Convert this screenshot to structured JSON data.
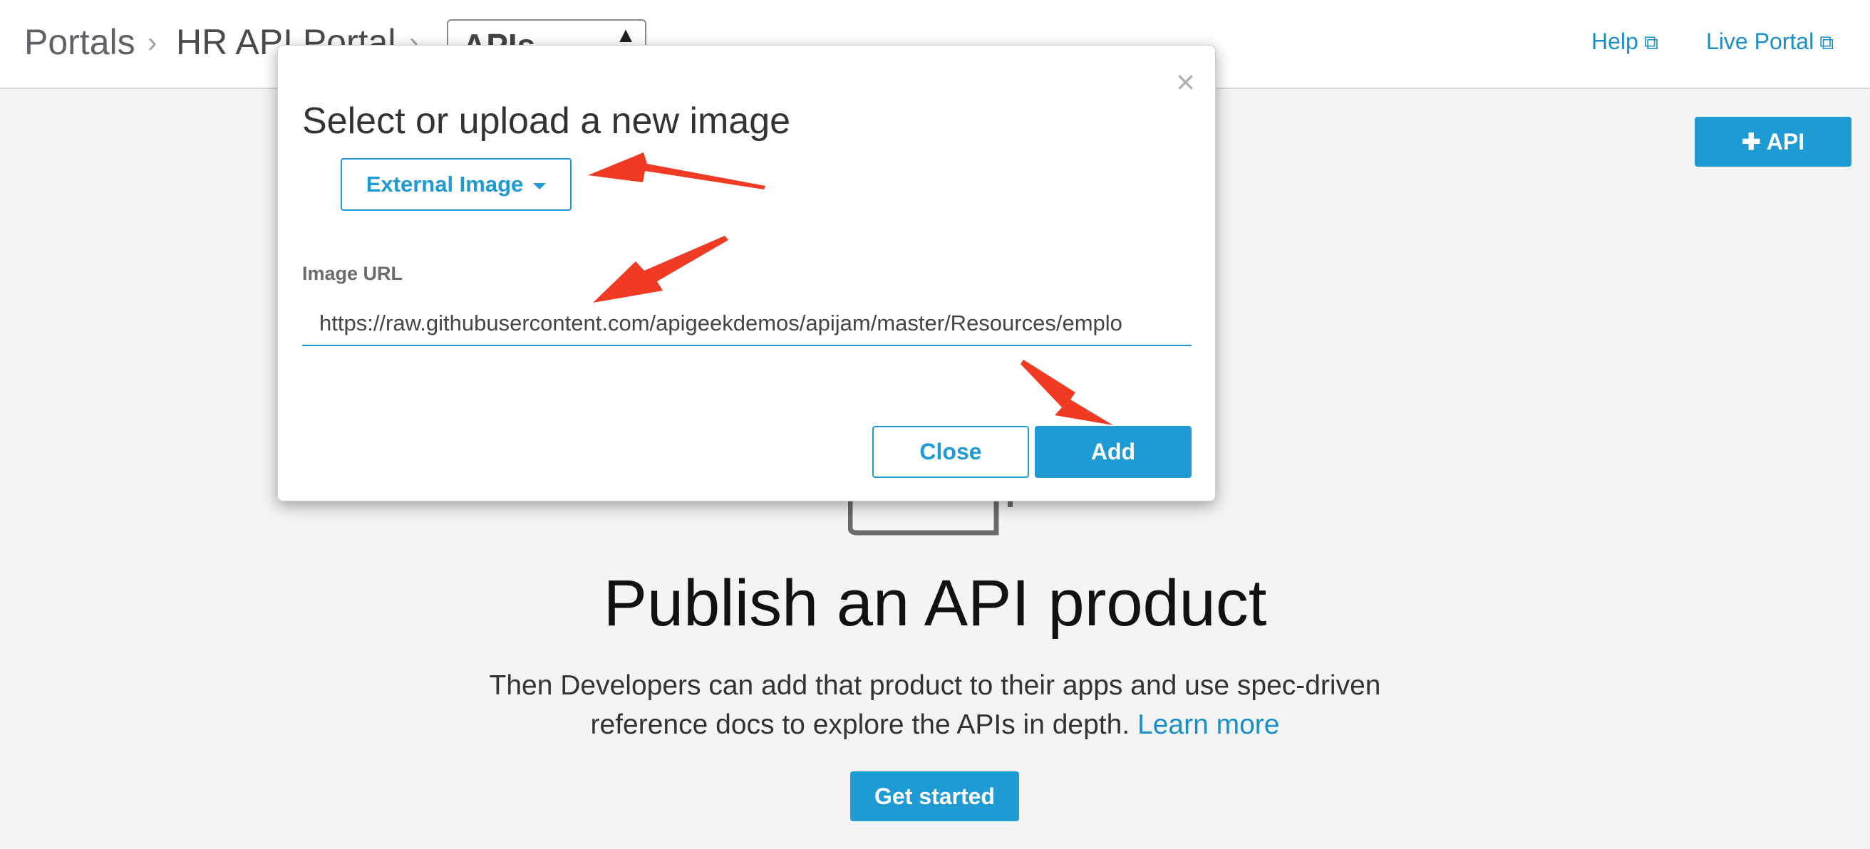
{
  "header": {
    "breadcrumb": [
      "Portals",
      "HR API Portal",
      "APIs"
    ],
    "help_label": "Help",
    "live_portal_label": "Live Portal",
    "icons": {
      "separator": "chevron-right-icon",
      "external": "external-link-icon",
      "select": "triangle-up-icon"
    }
  },
  "toolbar": {
    "add_api_label": "API",
    "add_icon": "plus-icon"
  },
  "modal": {
    "title": "Select or upload a new image",
    "close_icon": "close-icon",
    "source_dropdown": "External Image",
    "url_label": "Image URL",
    "url_value": "https://raw.githubusercontent.com/apigeekdemos/apijam/master/Resources/emplo",
    "close_button": "Close",
    "add_button": "Add"
  },
  "main": {
    "headline": "Publish an API product",
    "description": "Then Developers can add that product to their apps and use spec-driven reference docs to explore the APIs in depth.",
    "learn_more": "Learn more",
    "get_started": "Get started"
  },
  "colors": {
    "accent": "#1e9bd4",
    "annotation": "#f03a23",
    "background": "#f3f4f6"
  }
}
